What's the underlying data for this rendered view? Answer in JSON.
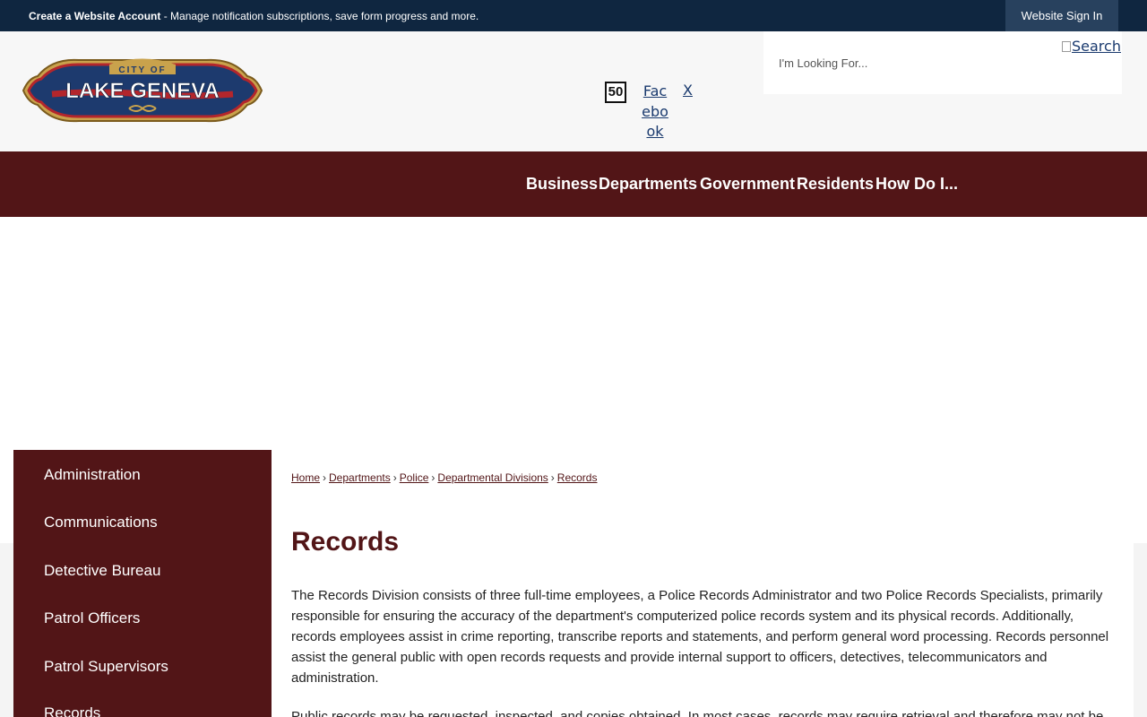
{
  "topbar": {
    "create_account_bold": "Create a Website Account",
    "create_account_rest": " - Manage notification subscriptions, save form progress and more.",
    "signin_label": "Website Sign In"
  },
  "header": {
    "logo": {
      "small_text": "CITY OF",
      "main_text": "LAKE GENEVA"
    },
    "social": {
      "icon_50_label": "50",
      "facebook_alt": "Facebook",
      "x_alt": "X"
    },
    "search": {
      "placeholder": "I'm Looking For...",
      "button_alt": "Search"
    }
  },
  "nav": {
    "items": [
      "Business",
      "Departments",
      "Government",
      "Residents",
      "How Do I..."
    ]
  },
  "sidebar": {
    "items": [
      "Administration",
      "Communications",
      "Detective Bureau",
      "Patrol Officers",
      "Patrol Supervisors",
      "Records"
    ]
  },
  "breadcrumb": {
    "items": [
      "Home",
      "Departments",
      "Police",
      "Departmental Divisions",
      "Records"
    ],
    "separator": "›"
  },
  "main": {
    "title": "Records",
    "paragraphs": [
      "The Records Division consists of three full-time employees, a Police Records Administrator and two Police Records Specialists, primarily responsible for ensuring the accuracy of the department's computerized police records system and its physical records. Additionally, records employees assist in crime reporting, transcribe reports and statements, and perform general word processing. Records personnel assist the general public with open records requests and provide internal support to officers, detectives, telecommunicators and administration.",
      "Public records may be requested, inspected, and copies obtained. In most cases, records may require retrieval and therefore may not be"
    ]
  },
  "colors": {
    "brand_maroon": "#521517",
    "topbar_navy": "#0f2640",
    "signin_bg": "#28415e"
  }
}
